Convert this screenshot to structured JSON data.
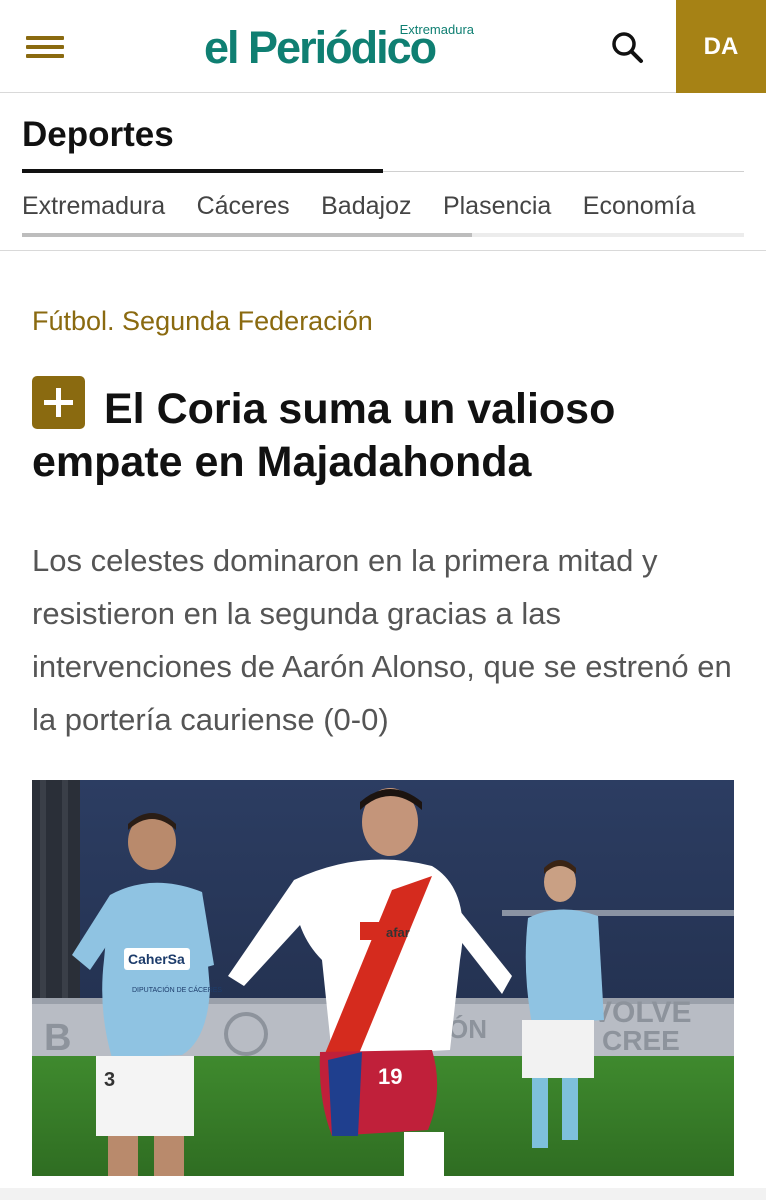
{
  "header": {
    "menu_icon": "hamburger-menu-icon",
    "logo_main": "el Periódico",
    "logo_sub": "Extremadura",
    "search_icon": "search-icon",
    "user_initials": "DA",
    "brand_color": "#0f7f72",
    "accent_color": "#a68215"
  },
  "section": {
    "title": "Deportes",
    "subnav": [
      "Extremadura",
      "Cáceres",
      "Badajoz",
      "Plasencia",
      "Economía"
    ]
  },
  "article": {
    "kicker": "Fútbol. Segunda Federación",
    "premium_icon": "plus-icon",
    "headline": "El Coria suma un valioso empate en Majadahonda",
    "standfirst": "Los celestes dominaron en la primera mitad y resistieron en la segunda gracias a las intervenciones de Aarón Alonso, que se estrenó en la portería cauriense (0-0)",
    "photo": {
      "sponsor_text": "CaherSa",
      "sponsor_sub": "DIPUTACIÓN DE CÁCERES",
      "jersey_number_left": "3",
      "jersey_number_center": "19",
      "shirt_brand": "afar",
      "banner_text_left": "CIÓN",
      "banner_text_right": "VOLVE",
      "banner_text_right2": "CREE"
    }
  }
}
